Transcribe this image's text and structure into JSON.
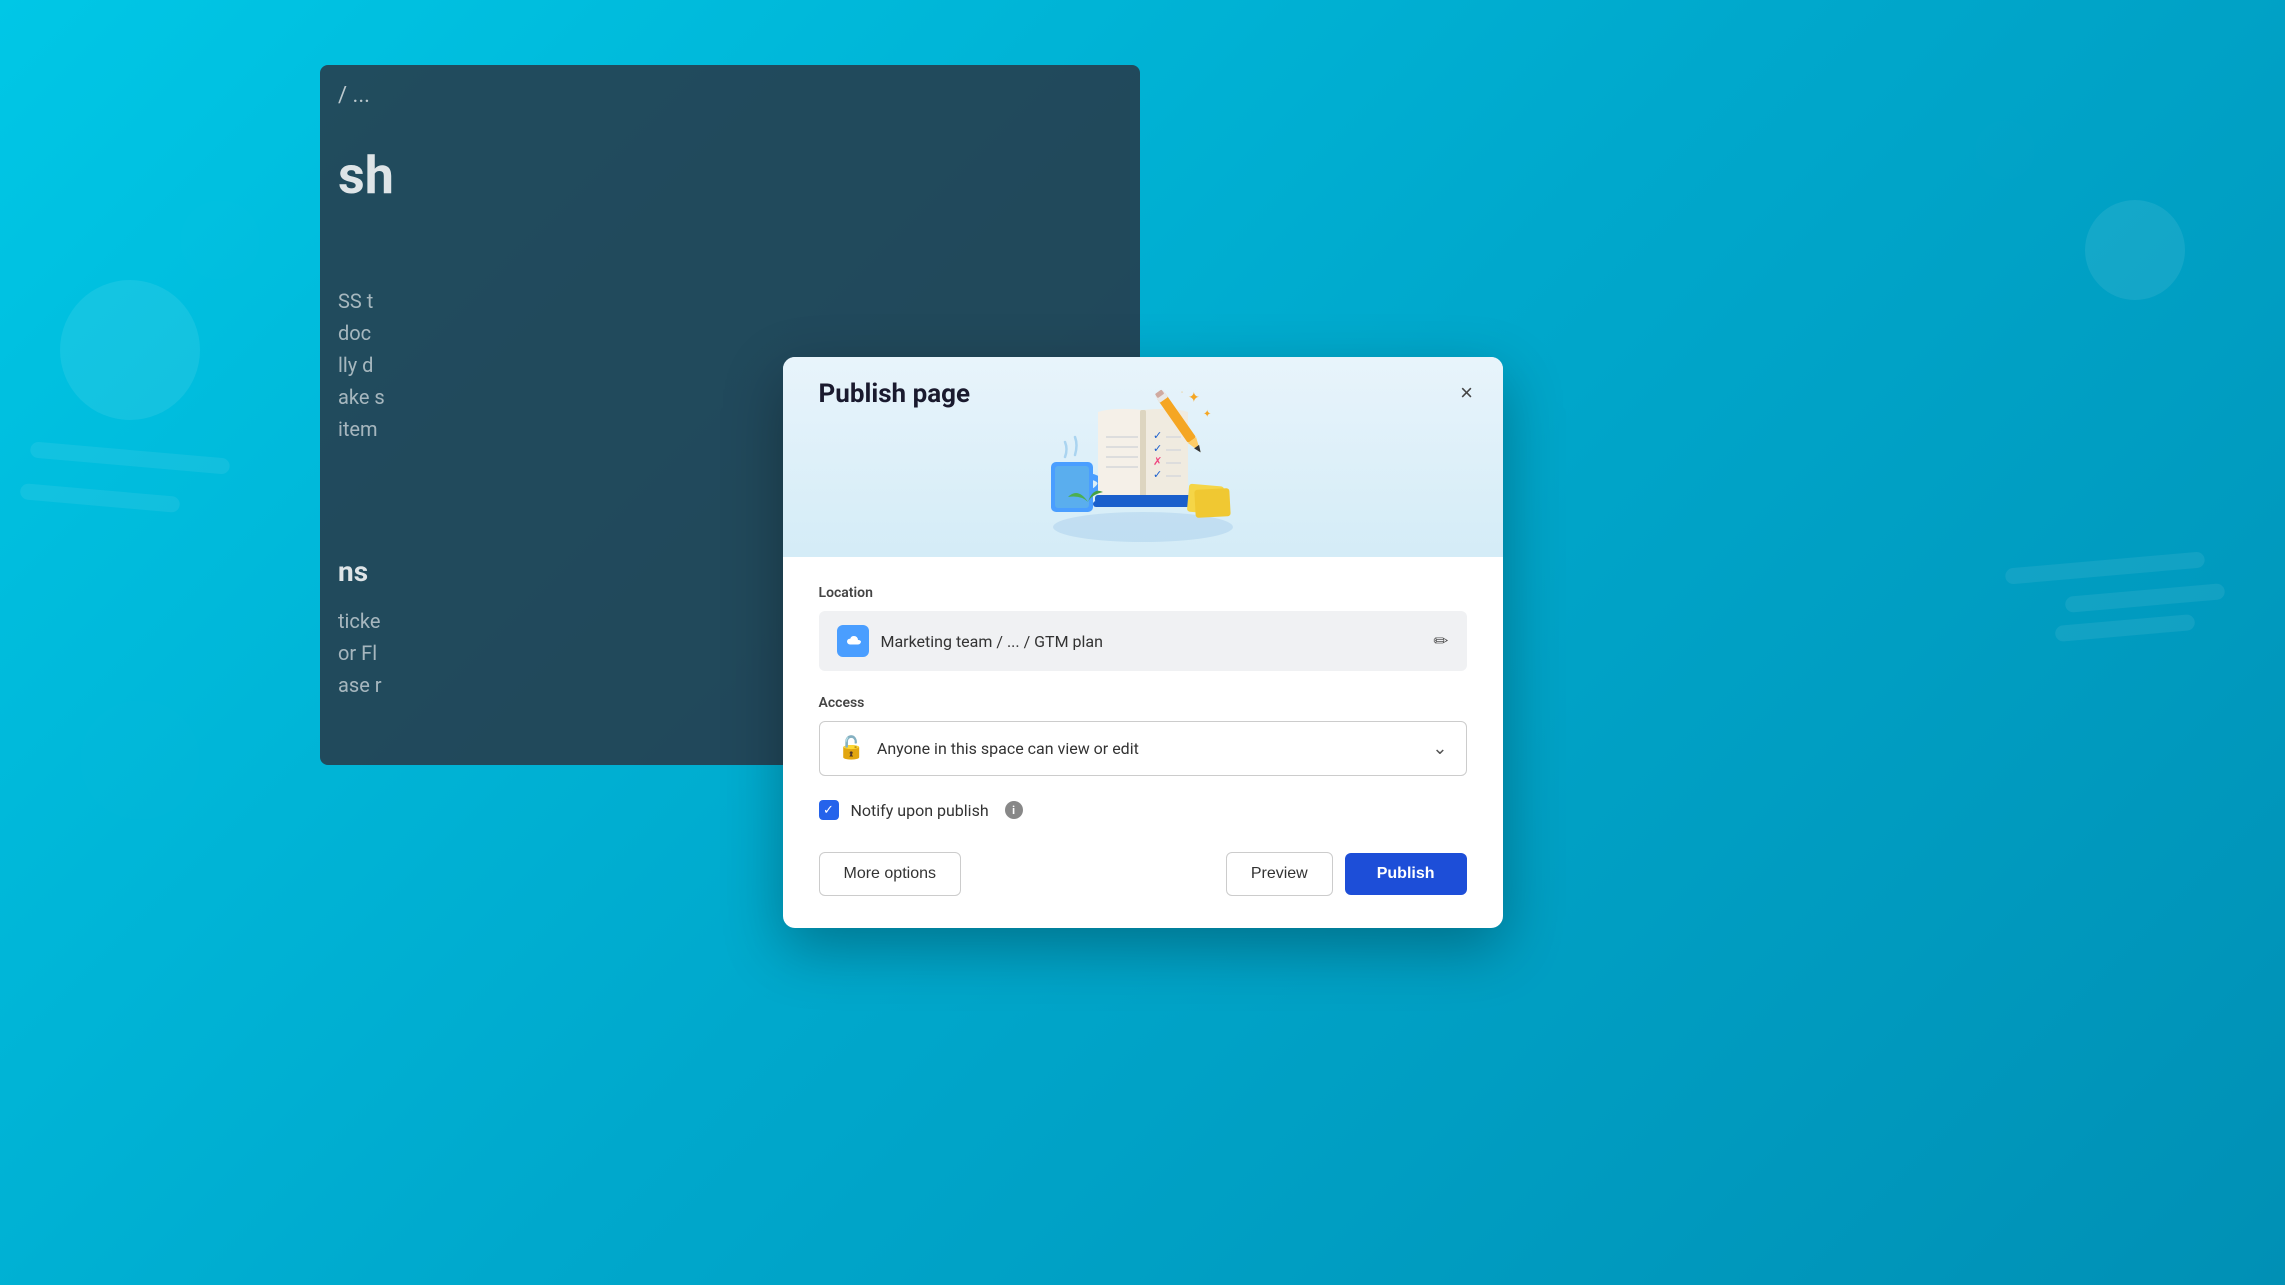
{
  "background": {
    "color_start": "#00c7e6",
    "color_end": "#0090b5"
  },
  "page_behind": {
    "breadcrumb": "/ ...",
    "heading": "sh",
    "body_line1": "SS t",
    "body_line2": "doc",
    "body_line3": "lly d",
    "body_line4": "ake s",
    "body_line5": "item",
    "subtitle": "ns",
    "sub_body_line1": "ticke",
    "sub_body_line2": "or Fl",
    "sub_body_line3": "ase r"
  },
  "modal": {
    "title": "Publish page",
    "close_label": "×",
    "location": {
      "label": "Location",
      "path": "Marketing team / ... / GTM plan",
      "icon_label": "space-icon",
      "edit_icon": "✏"
    },
    "access": {
      "label": "Access",
      "value": "Anyone in this space can view or edit",
      "lock_icon": "🔓",
      "chevron_icon": "⌄"
    },
    "notify": {
      "label": "Notify upon publish",
      "checked": true,
      "info_icon": "i"
    },
    "buttons": {
      "more_options": "More options",
      "preview": "Preview",
      "publish": "Publish"
    }
  }
}
